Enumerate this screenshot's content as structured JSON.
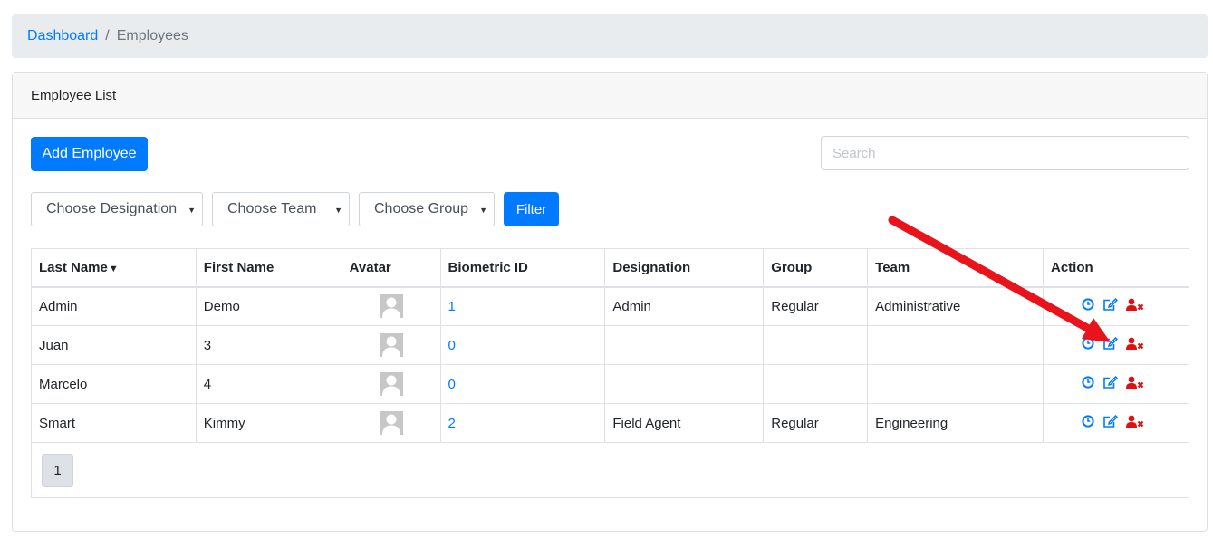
{
  "breadcrumb": {
    "parent": "Dashboard",
    "separator": "/",
    "current": "Employees"
  },
  "card": {
    "title": "Employee List"
  },
  "toolbar": {
    "add_label": "Add Employee",
    "search_placeholder": "Search",
    "filter_label": "Filter"
  },
  "filters": {
    "designation": "Choose Designation",
    "team": "Choose Team",
    "group": "Choose Group"
  },
  "table": {
    "headers": [
      "Last Name",
      "First Name",
      "Avatar",
      "Biometric ID",
      "Designation",
      "Group",
      "Team",
      "Action"
    ],
    "rows": [
      {
        "last": "Admin",
        "first": "Demo",
        "bio": "1",
        "designation": "Admin",
        "group": "Regular",
        "team": "Administrative"
      },
      {
        "last": "Juan",
        "first": "3",
        "bio": "0",
        "designation": "",
        "group": "",
        "team": ""
      },
      {
        "last": "Marcelo",
        "first": "4",
        "bio": "0",
        "designation": "",
        "group": "",
        "team": ""
      },
      {
        "last": "Smart",
        "first": "Kimmy",
        "bio": "2",
        "designation": "Field Agent",
        "group": "Regular",
        "team": "Engineering"
      }
    ]
  },
  "pagination": {
    "current_page": "1"
  },
  "icons": {
    "avatar": "user-silhouette-icon",
    "attendance": "clock-icon",
    "edit": "edit-icon",
    "delete": "user-times-icon",
    "sort": "caret-down-icon",
    "dropdown": "caret-down-icon"
  },
  "colors": {
    "primary": "#007bff",
    "danger": "#e01010",
    "annotation_arrow": "#e8131b"
  }
}
